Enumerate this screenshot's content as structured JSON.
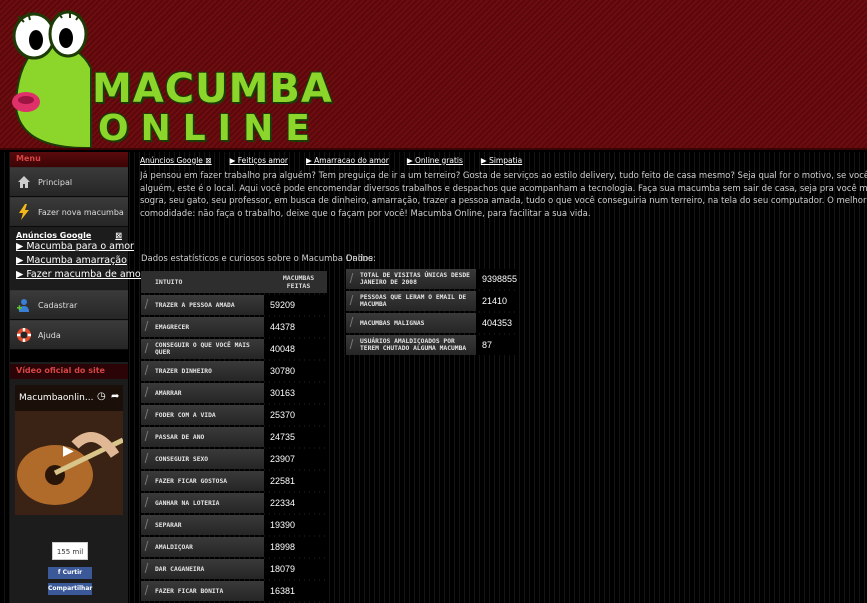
{
  "logo": {
    "line1": "MACUMBA",
    "line2": "ONLINE"
  },
  "sidebar": {
    "menu_title": "Menu",
    "items": [
      {
        "label": "Principal",
        "icon": "home-icon"
      },
      {
        "label": "Fazer nova macumba",
        "icon": "lightning-icon"
      }
    ],
    "ads_title": "Anúncios Google",
    "ad_links": [
      "▶ Macumba para o amor",
      "▶ Macumba amarração",
      "▶ Fazer macumba de amor"
    ],
    "items2": [
      {
        "label": "Cadastrar",
        "icon": "add-user-icon"
      },
      {
        "label": "Ajuda",
        "icon": "lifebuoy-icon"
      }
    ],
    "video_title": "Vídeo oficial do site",
    "video_caption": "Macumbaonlin...",
    "like_count": "155 mil",
    "like_button": "Curtir",
    "share_button": "Compartilhar"
  },
  "nav": {
    "ads_label": "Anúncios Google",
    "links": [
      "▶ Feitiços amor",
      "▶ Amarracao do amor",
      "▶ Online gratis",
      "▶ Simpatia"
    ]
  },
  "intro": [
    "Já pensou em fazer trabalho pra alguém? Tem preguiça de ir a um terreiro? Gosta de serviços ao estilo delivery, tudo feito de casa mesmo? Seja qual for o motivo, se você deseja fazer um trabalho pa",
    "alguém, este é o local. Aqui você pode encomendar diversos trabalhos e despachos que acompanham a tecnologia. Faça sua macumba sem sair de casa, seja pra você mesmo ou para o seu vizinho, su",
    "sogra, seu gato, seu professor, em busca de dinheiro, amarração, trazer a pessoa amada, tudo o que você conseguiria num terreiro, na tela do seu computador. O melhor de tudo: É GRÁTIS. Tenl",
    "comodidade: não faça o trabalho, deixe que o façam por você! Macumba Online, para facilitar a sua vida."
  ],
  "stats": {
    "caption": "Dados estatísticos e curiosos sobre o Macumba Online:",
    "col_intent": "INTUITO",
    "col_count": "MACUMBAS FEITAS",
    "rows": [
      {
        "label": "TRAZER A PESSOA AMADA",
        "value": "59209"
      },
      {
        "label": "EMAGRECER",
        "value": "44378"
      },
      {
        "label": "CONSEGUIR O QUE VOCÊ MAIS QUER",
        "value": "40048"
      },
      {
        "label": "TRAZER DINHEIRO",
        "value": "30780"
      },
      {
        "label": "AMARRAR",
        "value": "30163"
      },
      {
        "label": "FODER COM A VIDA",
        "value": "25370"
      },
      {
        "label": "PASSAR DE ANO",
        "value": "24735"
      },
      {
        "label": "CONSEGUIR SEXO",
        "value": "23907"
      },
      {
        "label": "FAZER FICAR GOSTOSA",
        "value": "22581"
      },
      {
        "label": "GANHAR NA LOTERIA",
        "value": "22334"
      },
      {
        "label": "SEPARAR",
        "value": "19390"
      },
      {
        "label": "AMALDIÇOAR",
        "value": "18998"
      },
      {
        "label": "DAR CAGANEIRA",
        "value": "18079"
      },
      {
        "label": "FAZER FICAR BONITA",
        "value": "16381"
      }
    ]
  },
  "dados": {
    "caption": "Dados",
    "rows": [
      {
        "label": "TOTAL DE VISITAS ÚNICAS DESDE JANEIRO DE 2008",
        "value": "9398855"
      },
      {
        "label": "PESSOAS QUE LERAM O EMAIL DE MACUMBA",
        "value": "21410"
      },
      {
        "label": "MACUMBAS MALIGNAS",
        "value": "404353"
      },
      {
        "label": "USUÁRIOS AMALDIÇOADOS POR TEREM CHUTADO ALGUMA MACUMBA",
        "value": "87"
      }
    ]
  }
}
